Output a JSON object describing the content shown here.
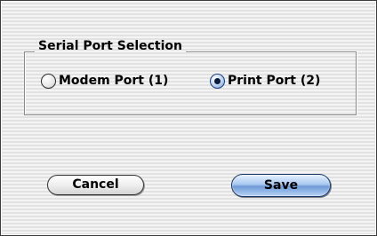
{
  "dialog": {
    "group_title": "Serial Port Selection",
    "options": [
      {
        "label": "Modem Port (1)",
        "selected": false
      },
      {
        "label": "Print Port (2)",
        "selected": true
      }
    ],
    "buttons": {
      "cancel_label": "Cancel",
      "save_label": "Save"
    }
  }
}
